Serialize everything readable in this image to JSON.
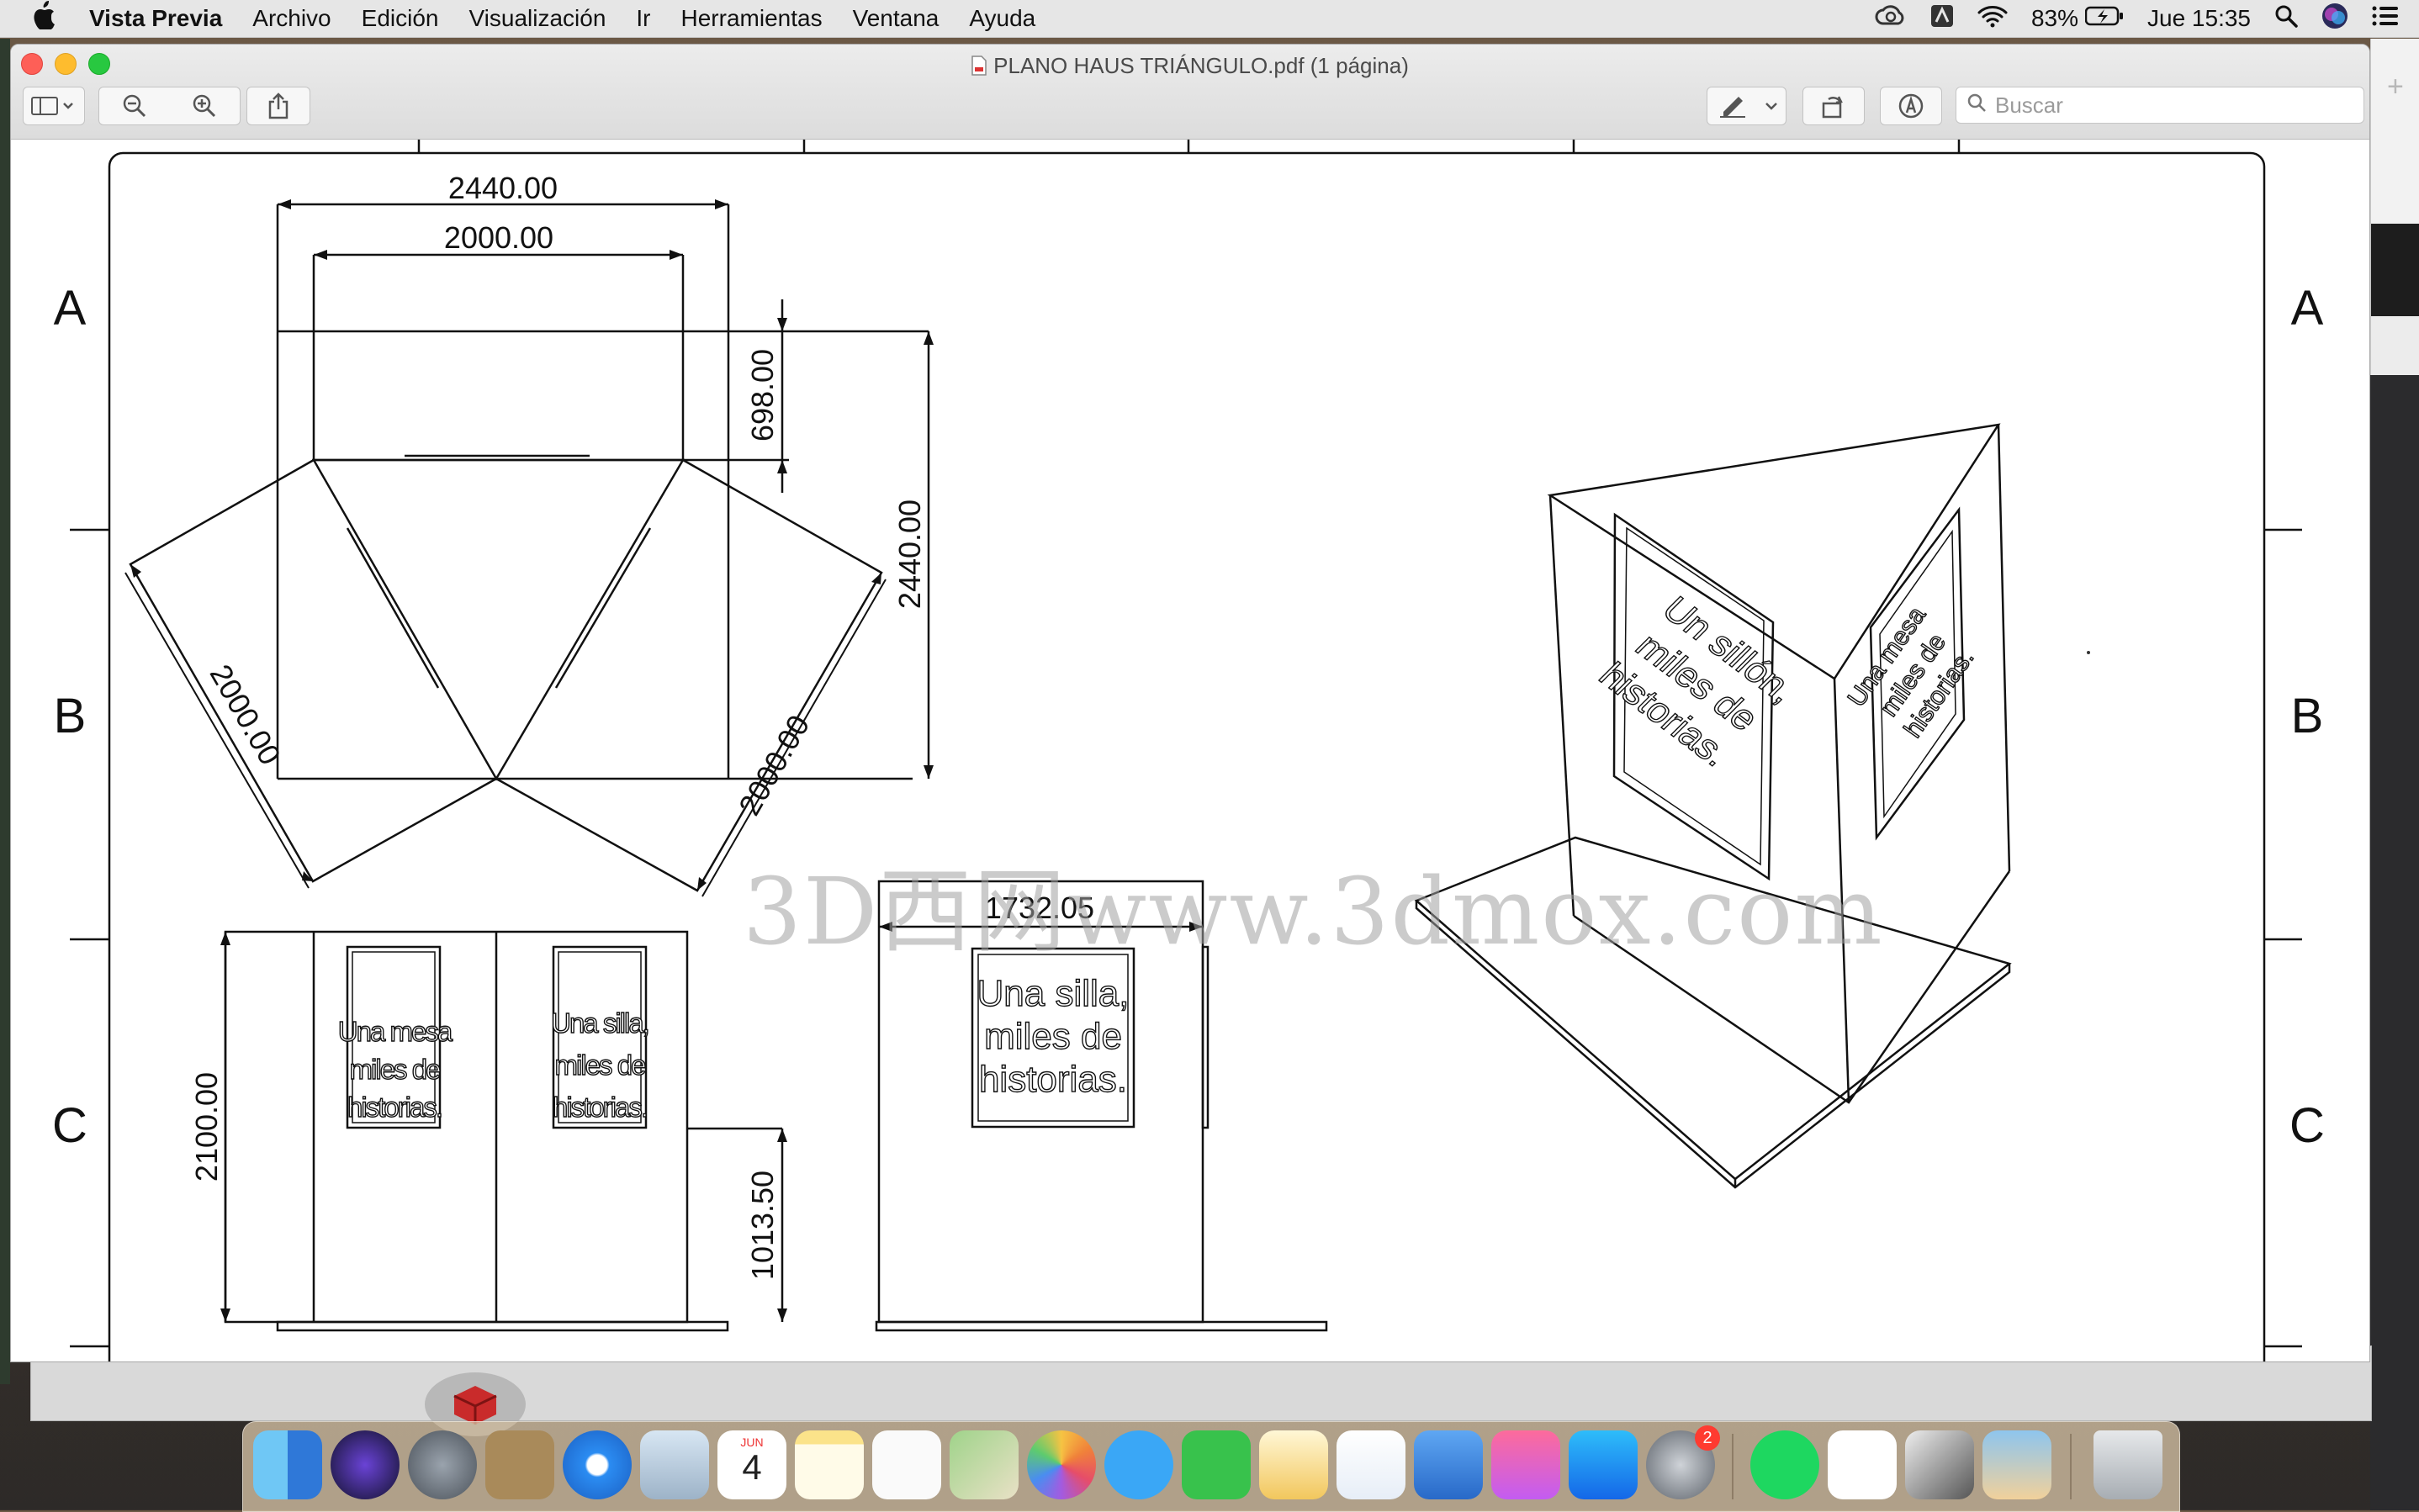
{
  "menubar": {
    "app_name": "Vista Previa",
    "items": [
      "Archivo",
      "Edición",
      "Visualización",
      "Ir",
      "Herramientas",
      "Ventana",
      "Ayuda"
    ],
    "battery": "83%",
    "clock": "Jue 15:35"
  },
  "window": {
    "title": "PLANO HAUS TRIÁNGULO.pdf (1 página)",
    "search_placeholder": "Buscar"
  },
  "drawing": {
    "row_labels": [
      "A",
      "B",
      "C"
    ],
    "dims": {
      "top_outer": "2440.00",
      "top_inner": "2000.00",
      "depth": "698.00",
      "height_right": "2440.00",
      "diag_left": "2000.00",
      "diag_right": "2000.00",
      "side_width": "1732.05",
      "elev_height": "2100.00",
      "small_height": "1013.50"
    },
    "signs": {
      "mesa": [
        "Una mesa",
        "miles de",
        "historias."
      ],
      "silla_small": [
        "Una silla,",
        "miles de",
        "historias."
      ],
      "silla_large": [
        "Una silla,",
        "miles de",
        "historias."
      ],
      "sillon": [
        "Un sillón,",
        "miles de",
        "historias."
      ],
      "mesa_iso": [
        "Una mesa",
        "miles de",
        "historias."
      ]
    }
  },
  "watermark": "3D西网www.3dmox.com",
  "dock": {
    "calendar_month": "JUN",
    "calendar_day": "4",
    "settings_badge": "2"
  }
}
